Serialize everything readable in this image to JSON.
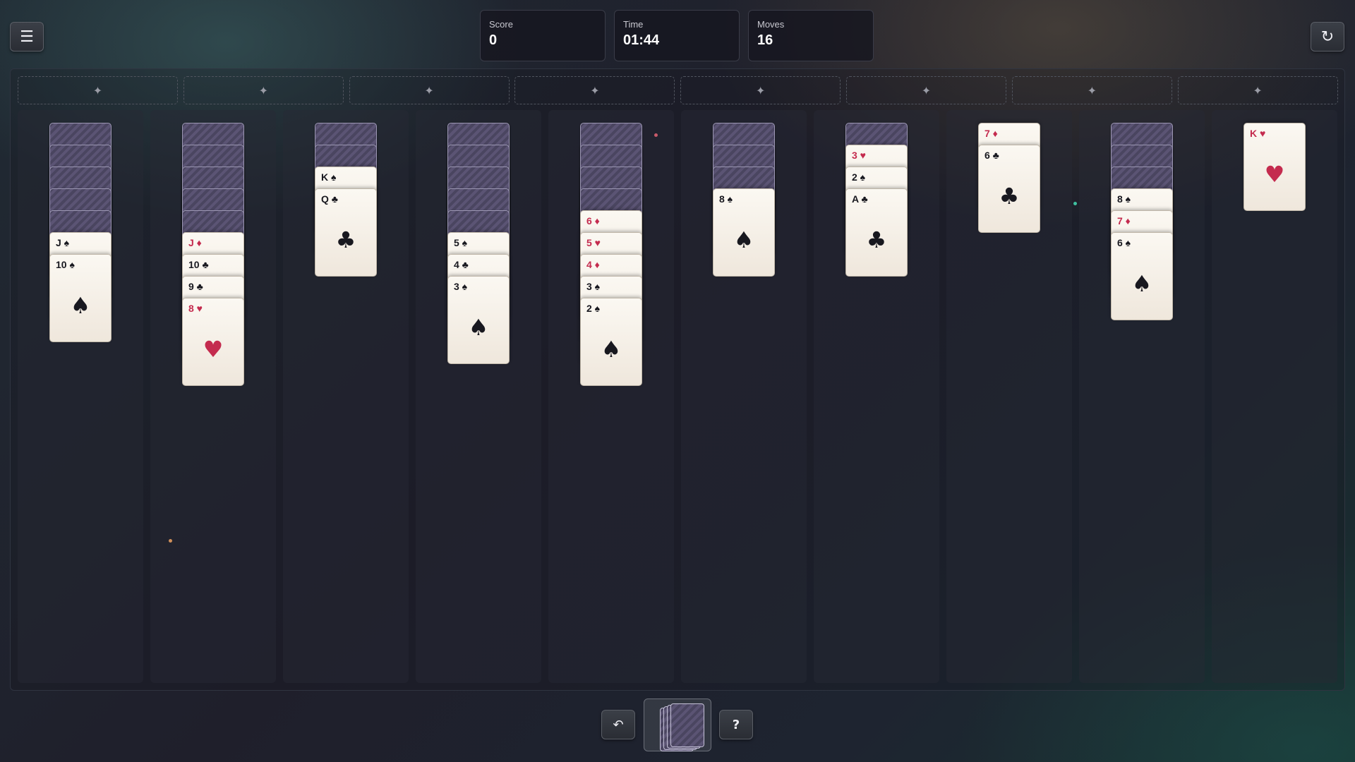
{
  "header": {
    "menu_icon": "☰",
    "restart_icon": "↻",
    "stats": [
      {
        "label": "Score",
        "value": "0"
      },
      {
        "label": "Time",
        "value": "01:44"
      },
      {
        "label": "Moves",
        "value": "16"
      }
    ]
  },
  "foundations": {
    "count": 8,
    "placeholder_icon": "✦"
  },
  "tableau": [
    {
      "face_down": 5,
      "face_up": [
        {
          "rank": "J",
          "suit": "♠",
          "color": "black"
        },
        {
          "rank": "10",
          "suit": "♠",
          "color": "black"
        }
      ]
    },
    {
      "face_down": 5,
      "face_up": [
        {
          "rank": "J",
          "suit": "♦",
          "color": "red"
        },
        {
          "rank": "10",
          "suit": "♣",
          "color": "black"
        },
        {
          "rank": "9",
          "suit": "♣",
          "color": "black"
        },
        {
          "rank": "8",
          "suit": "♥",
          "color": "red"
        }
      ]
    },
    {
      "face_down": 2,
      "face_up": [
        {
          "rank": "K",
          "suit": "♠",
          "color": "black"
        },
        {
          "rank": "Q",
          "suit": "♣",
          "color": "black"
        }
      ]
    },
    {
      "face_down": 5,
      "face_up": [
        {
          "rank": "5",
          "suit": "♠",
          "color": "black"
        },
        {
          "rank": "4",
          "suit": "♣",
          "color": "black"
        },
        {
          "rank": "3",
          "suit": "♠",
          "color": "black"
        }
      ]
    },
    {
      "face_down": 4,
      "face_up": [
        {
          "rank": "6",
          "suit": "♦",
          "color": "red"
        },
        {
          "rank": "5",
          "suit": "♥",
          "color": "red"
        },
        {
          "rank": "4",
          "suit": "♦",
          "color": "red"
        },
        {
          "rank": "3",
          "suit": "♠",
          "color": "black"
        },
        {
          "rank": "2",
          "suit": "♠",
          "color": "black"
        }
      ]
    },
    {
      "face_down": 3,
      "face_up": [
        {
          "rank": "8",
          "suit": "♠",
          "color": "black"
        }
      ]
    },
    {
      "face_down": 1,
      "face_up": [
        {
          "rank": "3",
          "suit": "♥",
          "color": "red"
        },
        {
          "rank": "2",
          "suit": "♠",
          "color": "black"
        },
        {
          "rank": "A",
          "suit": "♣",
          "color": "black"
        }
      ]
    },
    {
      "face_down": 0,
      "face_up": [
        {
          "rank": "7",
          "suit": "♦",
          "color": "red"
        },
        {
          "rank": "6",
          "suit": "♣",
          "color": "black"
        }
      ]
    },
    {
      "face_down": 3,
      "face_up": [
        {
          "rank": "8",
          "suit": "♠",
          "color": "black"
        },
        {
          "rank": "7",
          "suit": "♦",
          "color": "red"
        },
        {
          "rank": "6",
          "suit": "♠",
          "color": "black"
        }
      ]
    },
    {
      "face_down": 0,
      "face_up": [
        {
          "rank": "K",
          "suit": "♥",
          "color": "red"
        }
      ]
    }
  ],
  "footer": {
    "undo_icon": "↶",
    "hint_label": "?",
    "stock_cards_visible": 4
  },
  "colors": {
    "red_suit": "#c42b4e",
    "black_suit": "#18181f",
    "card_face": "#fbf8f2",
    "card_back": "#4a4560"
  }
}
